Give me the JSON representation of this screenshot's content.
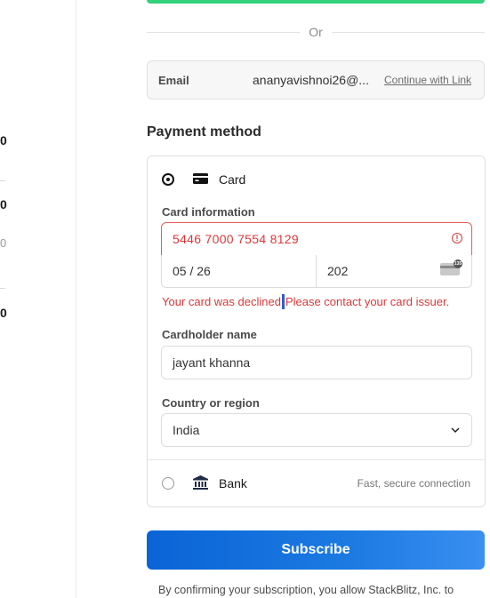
{
  "left_fragments": [
    "0",
    "0",
    "0",
    "0"
  ],
  "or_divider": "Or",
  "email": {
    "label": "Email",
    "value": "ananyavishnoi26@...",
    "link_label": "Continue with Link"
  },
  "payment_method_title": "Payment method",
  "card_option": {
    "label": "Card",
    "card_info_label": "Card information",
    "card_number": "5446 7000 7554 8129",
    "error_icon": "!",
    "expiry": "05 / 26",
    "cvc": "202",
    "cvc_badge": "135",
    "error_before": "Your card was declined",
    "error_after": "Please contact your card issuer.",
    "cardholder_label": "Cardholder name",
    "cardholder_value": "jayant khanna",
    "country_label": "Country or region",
    "country_value": "India"
  },
  "bank_option": {
    "label": "Bank",
    "note": "Fast, secure connection"
  },
  "subscribe_label": "Subscribe",
  "legal_text": "By confirming your subscription, you allow StackBlitz, Inc. to",
  "colors": {
    "accent_blue": "#0a64d6",
    "error_red": "#d9383a",
    "success_green": "#33d17a"
  },
  "icons": {
    "card": "card-icon",
    "bank": "bank-icon",
    "error": "error-icon",
    "cvc": "cvc-card-icon",
    "chevron": "chevron-down-icon"
  }
}
